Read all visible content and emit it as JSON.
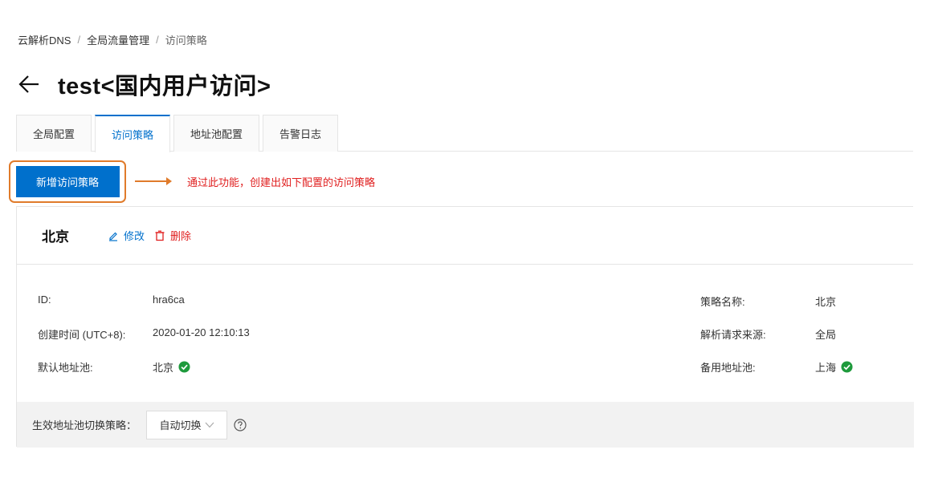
{
  "breadcrumb": {
    "items": [
      "云解析DNS",
      "全局流量管理"
    ],
    "current": "访问策略",
    "separator": "/"
  },
  "header": {
    "title": "test<国内用户访问>"
  },
  "tabs": [
    {
      "label": "全局配置"
    },
    {
      "label": "访问策略"
    },
    {
      "label": "地址池配置"
    },
    {
      "label": "告警日志"
    }
  ],
  "toolbar": {
    "add_label": "新增访问策略",
    "annotation": "通过此功能，创建出如下配置的访问策略"
  },
  "policy": {
    "name": "北京",
    "edit_label": "修改",
    "delete_label": "删除",
    "fields": {
      "id_label": "ID:",
      "id_value": "hra6ca",
      "created_label": "创建时间 (UTC+8):",
      "created_value": "2020-01-20 12:10:13",
      "default_pool_label": "默认地址池:",
      "default_pool_value": "北京",
      "policy_name_label": "策略名称:",
      "policy_name_value": "北京",
      "source_label": "解析请求来源:",
      "source_value": "全局",
      "backup_pool_label": "备用地址池:",
      "backup_pool_value": "上海"
    },
    "switch": {
      "label": "生效地址池切换策略：",
      "selected": "自动切换"
    }
  },
  "colors": {
    "primary": "#0070cc",
    "danger": "#e02020",
    "annotation": "#e07b2b",
    "success": "#1e9a3c"
  },
  "icons": {
    "back": "arrow-left-icon",
    "edit": "pencil-icon",
    "delete": "trash-icon",
    "status": "check-circle-icon",
    "help": "question-circle-icon",
    "dropdown": "chevron-down-icon"
  }
}
